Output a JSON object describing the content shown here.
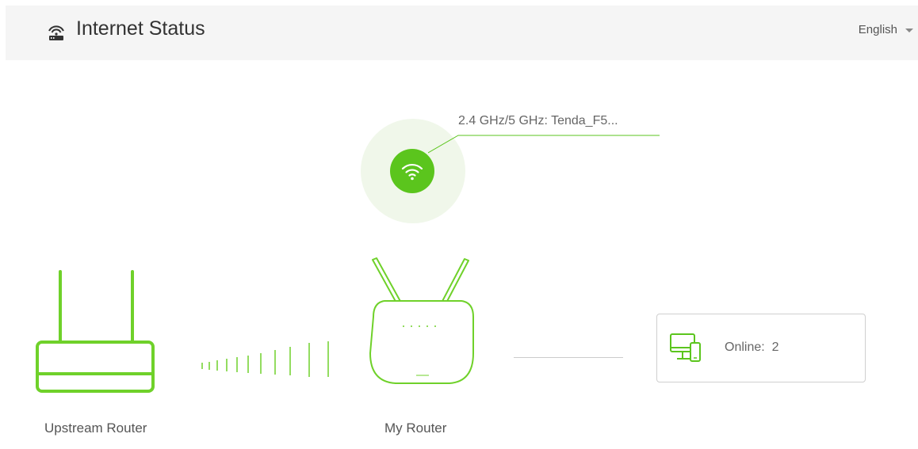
{
  "header": {
    "title": "Internet Status",
    "icon": "router-icon",
    "language": "English"
  },
  "wifi": {
    "icon": "wifi-icon",
    "ssid_text": "2.4 GHz/5 GHz: Tenda_F5..."
  },
  "topology": {
    "upstream_label": "Upstream Router",
    "my_router_label": "My Router",
    "devices_icon": "devices-icon",
    "online_label": "Online:",
    "online_count": "2"
  },
  "colors": {
    "accent": "#5bc51d",
    "accent_light": "#f0f7ea",
    "header_bg": "#f5f5f5"
  }
}
